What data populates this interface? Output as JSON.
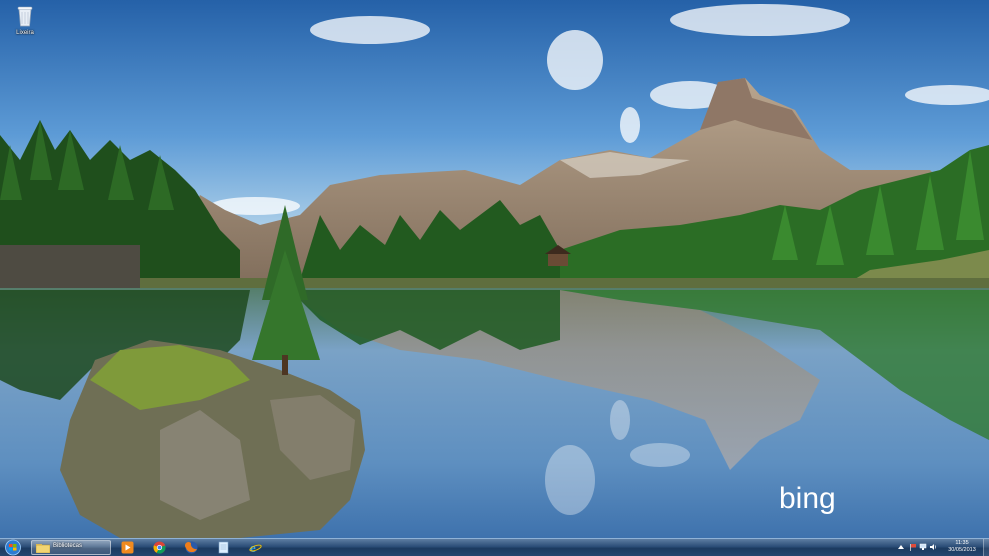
{
  "desktop": {
    "icons": [
      {
        "label": "Lixeira",
        "icon": "recycle-bin-icon"
      }
    ],
    "wallpaper_brand": "bing"
  },
  "taskbar": {
    "start_icon": "windows-orb-icon",
    "active_window_label": "Bibliotecas",
    "pinned": [
      {
        "name": "windows-media-player-icon"
      },
      {
        "name": "chrome-icon"
      },
      {
        "name": "firefox-icon"
      },
      {
        "name": "notepad-icon"
      },
      {
        "name": "internet-explorer-icon"
      }
    ],
    "tray": {
      "icons": [
        "show-hidden-icons-icon",
        "flag-icon",
        "network-icon",
        "volume-icon"
      ],
      "time": "11:35",
      "date": "30/05/2013"
    }
  },
  "colors": {
    "taskbar": "#2b4d77",
    "sky_top": "#2f6fb2",
    "lake": "#6d97c4"
  }
}
